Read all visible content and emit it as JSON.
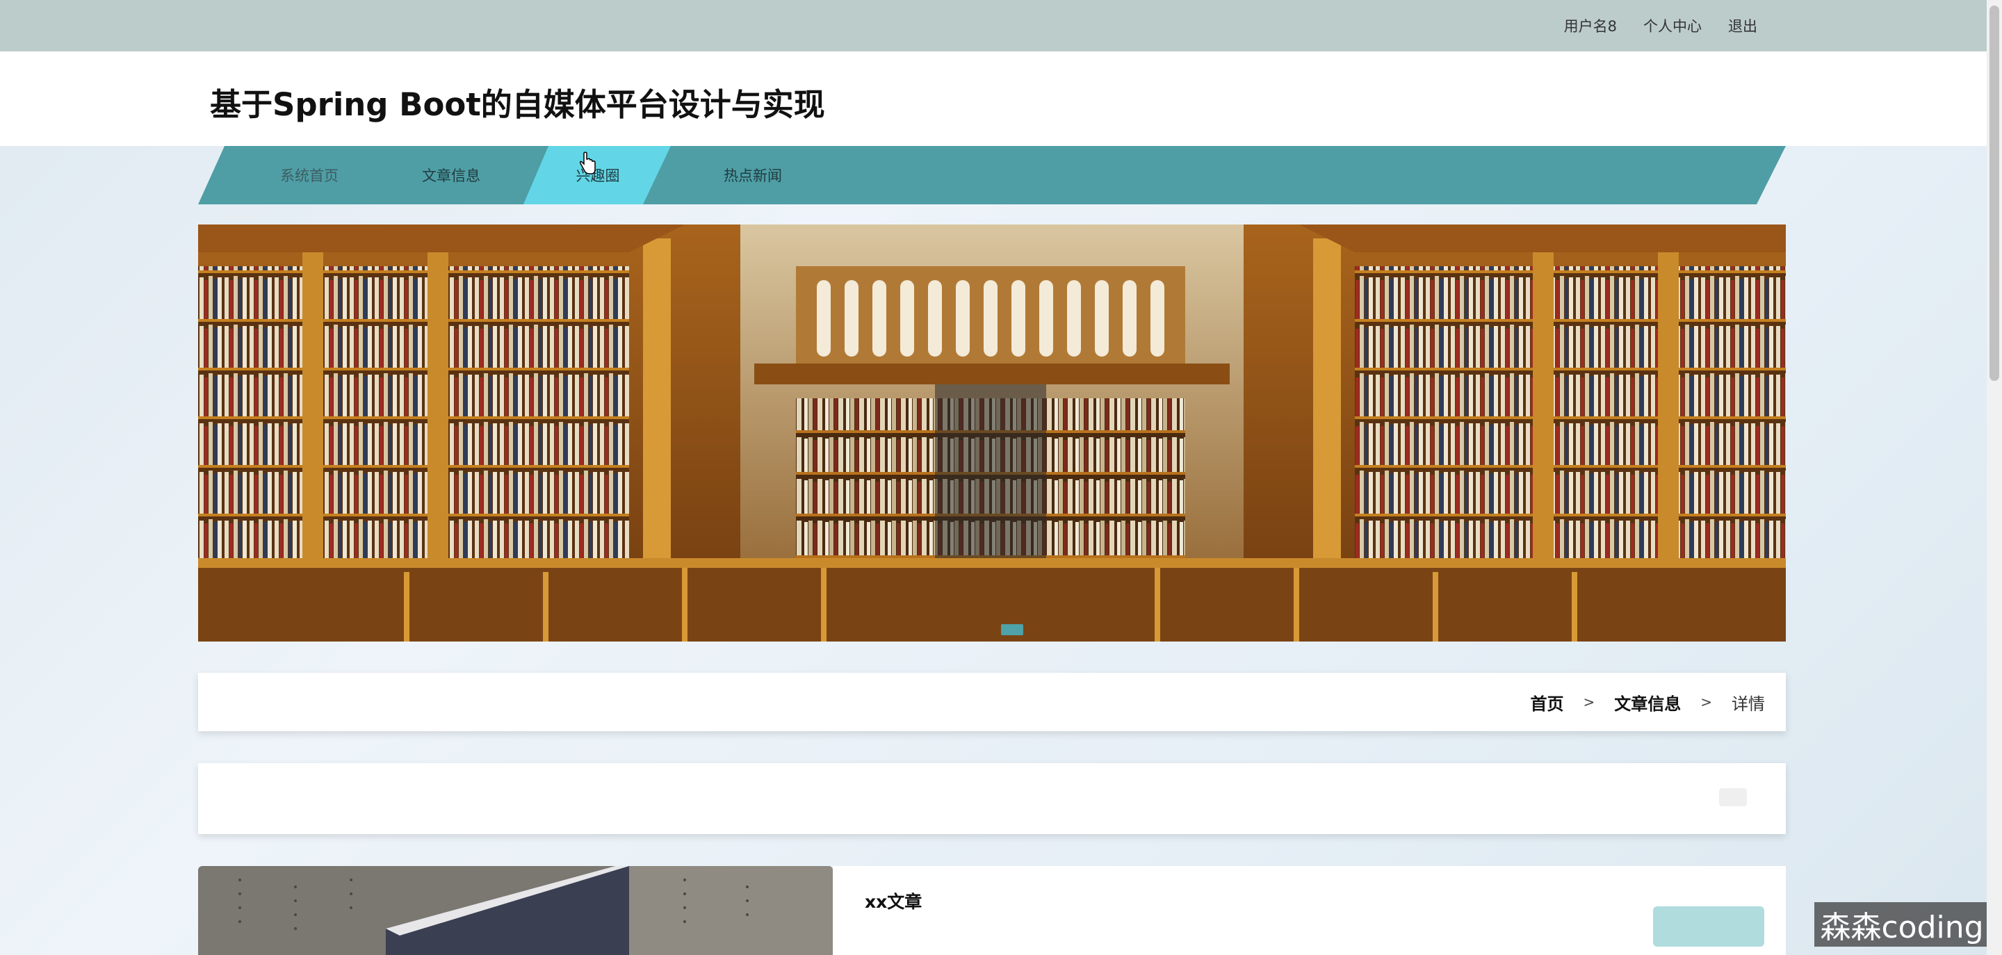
{
  "topbar": {
    "username": "用户名8",
    "profile": "个人中心",
    "logout": "退出"
  },
  "header": {
    "title": "基于Spring Boot的自媒体平台设计与实现"
  },
  "nav": {
    "items": [
      {
        "label": "系统首页",
        "active": false
      },
      {
        "label": "文章信息",
        "active": false
      },
      {
        "label": "兴趣圈",
        "active": true
      },
      {
        "label": "热点新闻",
        "active": false
      }
    ]
  },
  "banner": {
    "image": "library-interior",
    "active_slide": 1
  },
  "breadcrumb": {
    "home": "首页",
    "sep1": ">",
    "section": "文章信息",
    "sep2": ">",
    "current": "详情"
  },
  "article": {
    "title": "xx文章"
  },
  "watermark": "森森coding",
  "colors": {
    "topbar": "#bccccb",
    "nav": "#4f9ea5",
    "nav_active": "#62d6e6",
    "accent": "#4ea2a8"
  }
}
